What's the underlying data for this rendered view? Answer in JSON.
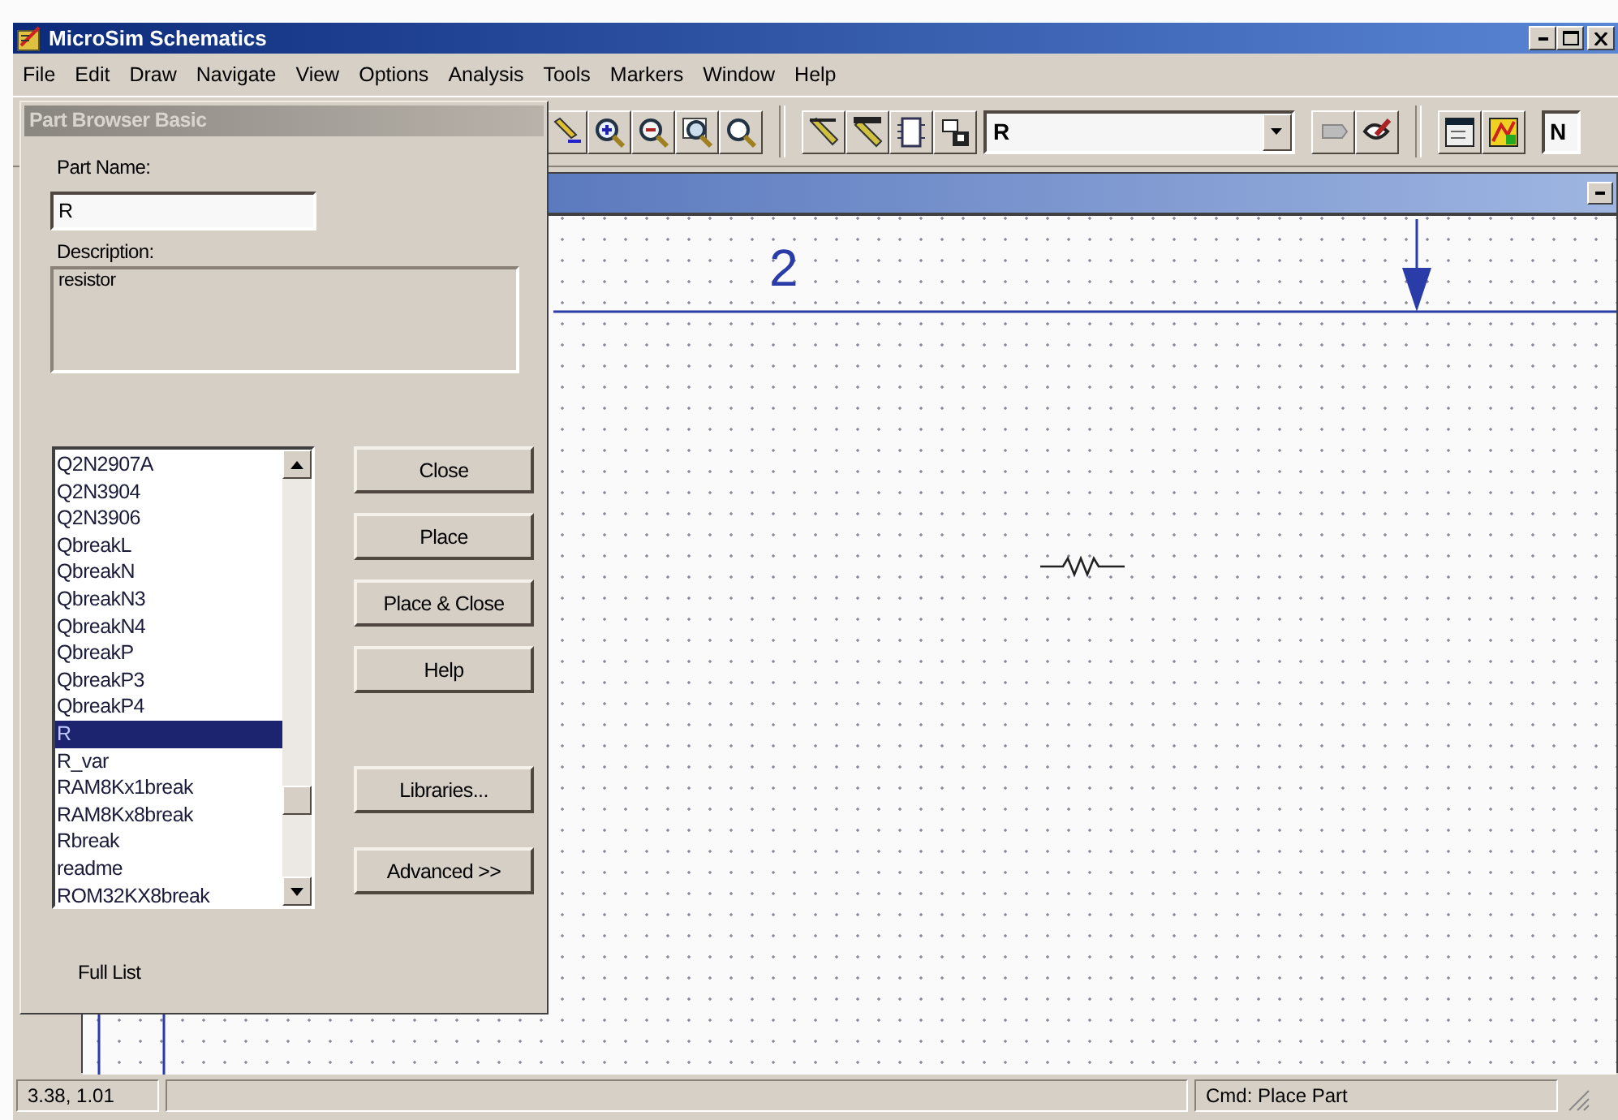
{
  "window": {
    "title": "MicroSim Schematics"
  },
  "menu": [
    {
      "label": "File"
    },
    {
      "label": "Edit"
    },
    {
      "label": "Draw"
    },
    {
      "label": "Navigate"
    },
    {
      "label": "View"
    },
    {
      "label": "Options"
    },
    {
      "label": "Analysis"
    },
    {
      "label": "Tools"
    },
    {
      "label": "Markers"
    },
    {
      "label": "Window"
    },
    {
      "label": "Help"
    }
  ],
  "toolbar": {
    "part_combo": {
      "value": "R"
    },
    "field_cut": {
      "value": "N"
    }
  },
  "sheet": {
    "frame_label": "2"
  },
  "part_browser": {
    "title": "Part Browser Basic",
    "part_name_label": "Part Name:",
    "part_name": "R",
    "description_label": "Description:",
    "description": "resistor",
    "parts": [
      {
        "name": "Q2N2907A",
        "selected": false
      },
      {
        "name": "Q2N3904",
        "selected": false
      },
      {
        "name": "Q2N3906",
        "selected": false
      },
      {
        "name": "QbreakL",
        "selected": false
      },
      {
        "name": "QbreakN",
        "selected": false
      },
      {
        "name": "QbreakN3",
        "selected": false
      },
      {
        "name": "QbreakN4",
        "selected": false
      },
      {
        "name": "QbreakP",
        "selected": false
      },
      {
        "name": "QbreakP3",
        "selected": false
      },
      {
        "name": "QbreakP4",
        "selected": false
      },
      {
        "name": "R",
        "selected": true
      },
      {
        "name": "R_var",
        "selected": false
      },
      {
        "name": "RAM8Kx1break",
        "selected": false
      },
      {
        "name": "RAM8Kx8break",
        "selected": false
      },
      {
        "name": "Rbreak",
        "selected": false
      },
      {
        "name": "readme",
        "selected": false
      },
      {
        "name": "ROM32KX8break",
        "selected": false
      }
    ],
    "buttons": [
      {
        "label": "Close",
        "kind": "close"
      },
      {
        "label": "Place",
        "kind": "place"
      },
      {
        "label": "Place & Close",
        "kind": "place-close"
      },
      {
        "label": "Help",
        "kind": "help"
      },
      {
        "label": "Libraries...",
        "kind": "libraries"
      },
      {
        "label": "Advanced >>",
        "kind": "advanced"
      }
    ],
    "full_list_label": "Full List"
  },
  "status_bar": {
    "coordinates": "3.38, 1.01",
    "command": "Cmd: Place Part"
  }
}
